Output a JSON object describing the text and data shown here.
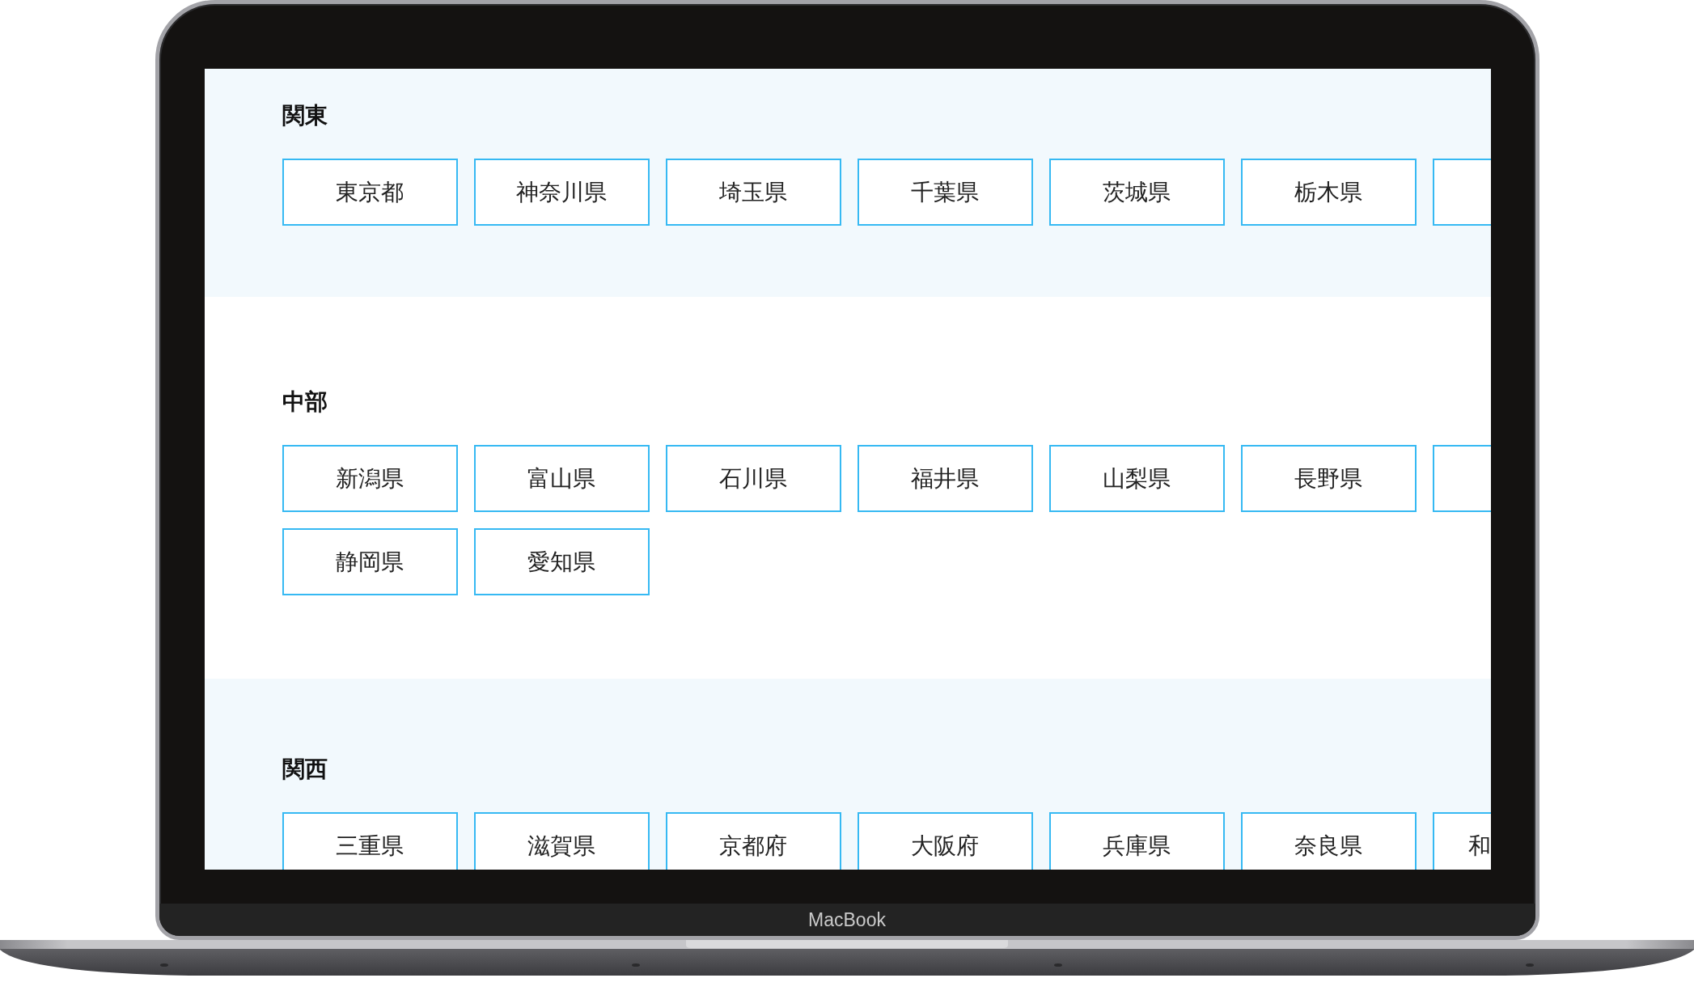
{
  "regions": [
    {
      "heading": "関東",
      "cut_bottom": false,
      "prefectures": [
        {
          "kind": "full",
          "label": "東京都"
        },
        {
          "kind": "full",
          "label": "神奈川県"
        },
        {
          "kind": "full",
          "label": "埼玉県"
        },
        {
          "kind": "full",
          "label": "千葉県"
        },
        {
          "kind": "full",
          "label": "茨城県"
        },
        {
          "kind": "full",
          "label": "栃木県"
        },
        {
          "kind": "partial"
        }
      ]
    },
    {
      "heading": "中部",
      "cut_bottom": false,
      "prefectures": [
        {
          "kind": "full",
          "label": "新潟県"
        },
        {
          "kind": "full",
          "label": "富山県"
        },
        {
          "kind": "full",
          "label": "石川県"
        },
        {
          "kind": "full",
          "label": "福井県"
        },
        {
          "kind": "full",
          "label": "山梨県"
        },
        {
          "kind": "full",
          "label": "長野県"
        },
        {
          "kind": "partial"
        },
        {
          "kind": "full",
          "label": "静岡県"
        },
        {
          "kind": "full",
          "label": "愛知県"
        }
      ]
    },
    {
      "heading": "関西",
      "cut_bottom": true,
      "prefectures": [
        {
          "kind": "full",
          "label": "三重県"
        },
        {
          "kind": "full",
          "label": "滋賀県"
        },
        {
          "kind": "full",
          "label": "京都府"
        },
        {
          "kind": "full",
          "label": "大阪府"
        },
        {
          "kind": "full",
          "label": "兵庫県"
        },
        {
          "kind": "full",
          "label": "奈良県"
        },
        {
          "kind": "partial",
          "label": "和"
        }
      ]
    }
  ],
  "device": {
    "label": "MacBook"
  }
}
